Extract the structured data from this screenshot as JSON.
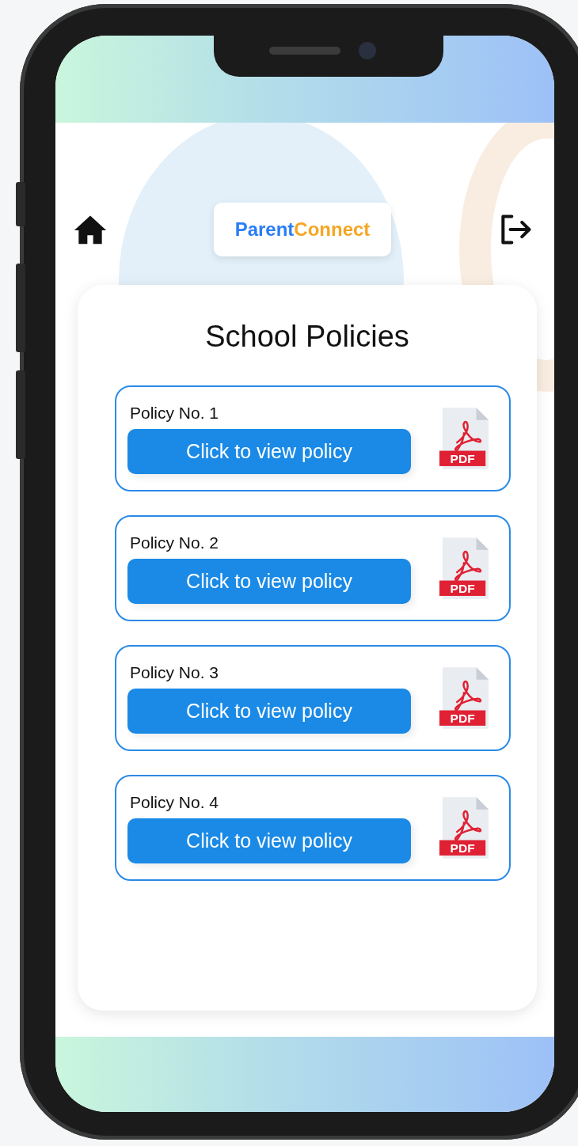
{
  "header": {
    "logo": {
      "first": "Parent",
      "second": "Connect"
    }
  },
  "page": {
    "title": "School Policies"
  },
  "policies": [
    {
      "label": "Policy No. 1",
      "button": "Click to view policy",
      "file_badge": "PDF"
    },
    {
      "label": "Policy No. 2",
      "button": "Click to view policy",
      "file_badge": "PDF"
    },
    {
      "label": "Policy No. 3",
      "button": "Click to view policy",
      "file_badge": "PDF"
    },
    {
      "label": "Policy No. 4",
      "button": "Click to view policy",
      "file_badge": "PDF"
    }
  ]
}
